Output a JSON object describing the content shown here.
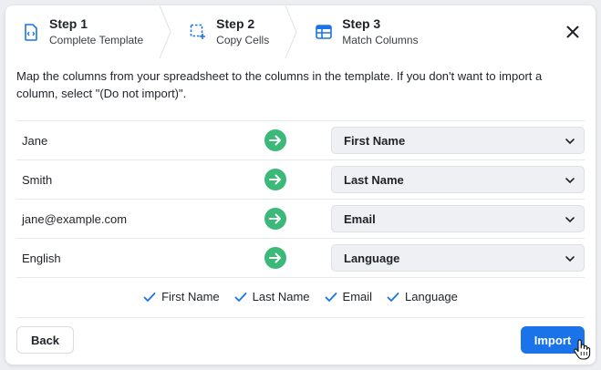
{
  "stepper": {
    "steps": [
      {
        "title": "Step 1",
        "subtitle": "Complete Template",
        "icon": "document-code-icon"
      },
      {
        "title": "Step 2",
        "subtitle": "Copy Cells",
        "icon": "select-cells-icon"
      },
      {
        "title": "Step 3",
        "subtitle": "Match Columns",
        "icon": "table-icon"
      }
    ],
    "close_icon": "close-icon"
  },
  "instructions": "Map the columns from your spreadsheet to the columns in the template. If you don't want to import a column, select \"(Do not import)\".",
  "mappings": [
    {
      "source": "Jane",
      "target": "First Name"
    },
    {
      "source": "Smith",
      "target": "Last Name"
    },
    {
      "source": "jane@example.com",
      "target": "Email"
    },
    {
      "source": "English",
      "target": "Language"
    }
  ],
  "summary": [
    "First Name",
    "Last Name",
    "Email",
    "Language"
  ],
  "buttons": {
    "back": "Back",
    "import": "Import"
  },
  "colors": {
    "accent": "#1a73e8",
    "arrow": "#3cb878",
    "check": "#1a73e8"
  }
}
